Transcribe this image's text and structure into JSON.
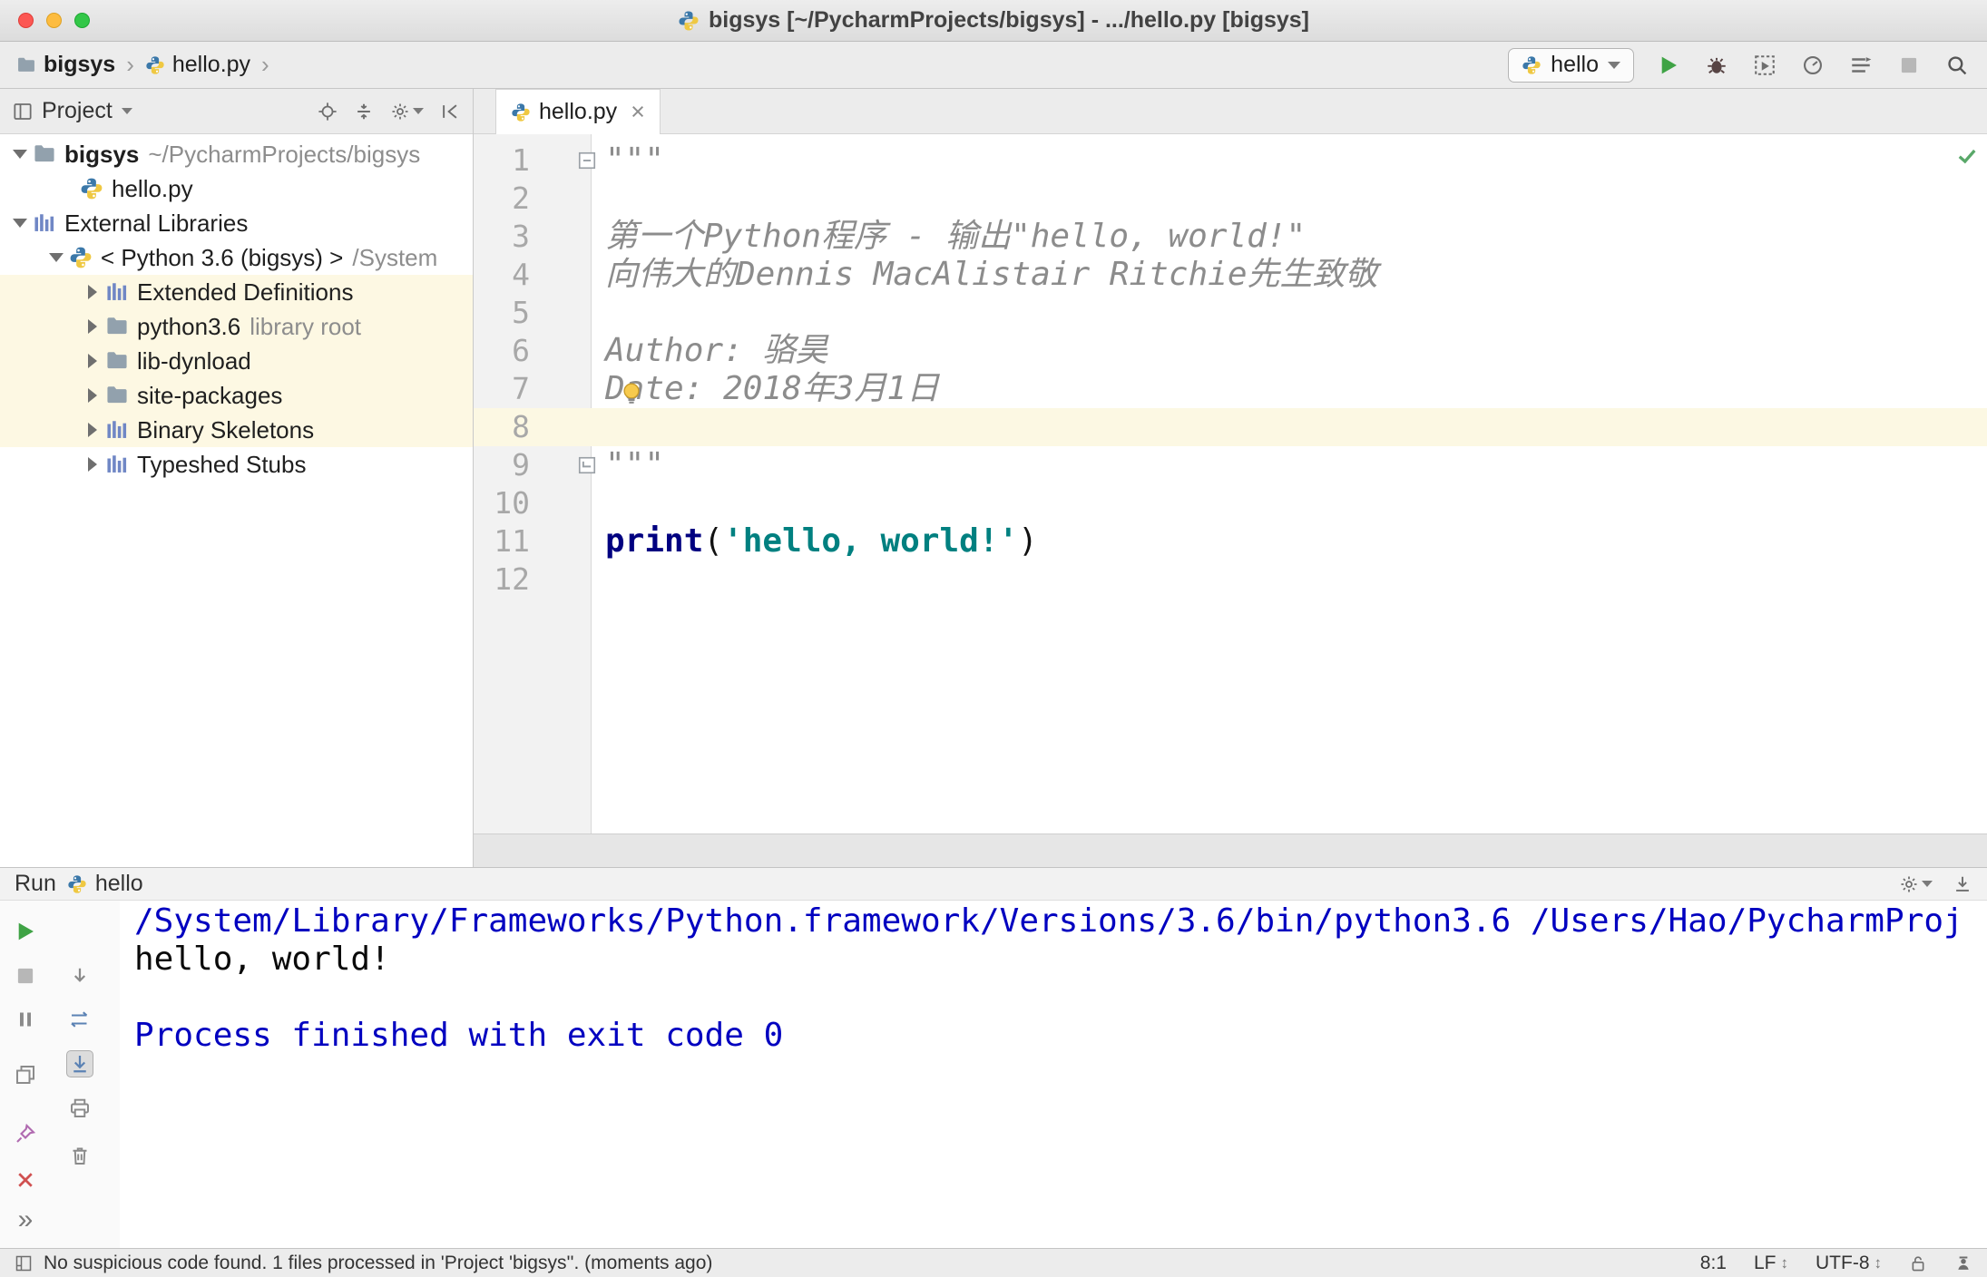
{
  "colors": {
    "accent_green": "#3fa345",
    "keyword": "#000080",
    "string": "#008080",
    "comment": "#8c8c8c",
    "console_system": "#0000c0",
    "library_row_bg": "#fdf8e3",
    "caret_line_bg": "#fcf8e3"
  },
  "title_bar": {
    "title": "bigsys [~/PycharmProjects/bigsys] - .../hello.py [bigsys]"
  },
  "nav": {
    "breadcrumb": {
      "project": "bigsys",
      "file": "hello.py"
    },
    "run_config": {
      "label": "hello"
    }
  },
  "project": {
    "title": "Project",
    "tree": [
      {
        "label": "bigsys",
        "suffix": "~/PycharmProjects/bigsys"
      },
      {
        "label": "hello.py"
      },
      {
        "label": "External Libraries"
      },
      {
        "label": "< Python 3.6 (bigsys) >",
        "suffix": "/System"
      },
      {
        "label": "Extended Definitions"
      },
      {
        "label": "python3.6",
        "suffix": "library root"
      },
      {
        "label": "lib-dynload"
      },
      {
        "label": "site-packages"
      },
      {
        "label": "Binary Skeletons"
      },
      {
        "label": "Typeshed Stubs"
      }
    ]
  },
  "editor": {
    "tab": "hello.py",
    "lines": [
      {
        "n": "1",
        "doc": "\"\"\""
      },
      {
        "n": "2",
        "doc": ""
      },
      {
        "n": "3",
        "doc": "第一个Python程序 - 输出\"hello, world!\""
      },
      {
        "n": "4",
        "doc": "向伟大的Dennis MacAlistair Ritchie先生致敬"
      },
      {
        "n": "5",
        "doc": ""
      },
      {
        "n": "6",
        "doc": "Author: 骆昊"
      },
      {
        "n": "7",
        "doc": "Date: 2018年3月1日"
      },
      {
        "n": "8",
        "doc": ""
      },
      {
        "n": "9",
        "doc": "\"\"\""
      },
      {
        "n": "10",
        "doc": ""
      },
      {
        "n": "11",
        "code": {
          "kw": "print",
          "open": "(",
          "str": "'hello, world!'",
          "close": ")"
        }
      },
      {
        "n": "12",
        "doc": ""
      }
    ]
  },
  "run": {
    "title": "Run",
    "tab": "hello",
    "more_label": "»",
    "console": [
      {
        "text": "/System/Library/Frameworks/Python.framework/Versions/3.6/bin/python3.6 /Users/Hao/PycharmProj"
      },
      {
        "text": "hello, world!"
      },
      {
        "text": ""
      },
      {
        "text": "Process finished with exit code 0"
      }
    ]
  },
  "status": {
    "message": "No suspicious code found. 1 files processed in 'Project 'bigsys''. (moments ago)",
    "caret": "8:1",
    "line_ending": "LF",
    "encoding": "UTF-8"
  }
}
